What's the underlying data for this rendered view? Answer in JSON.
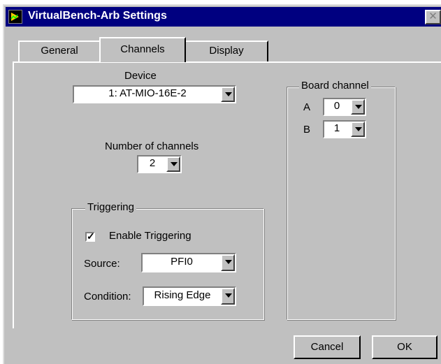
{
  "window": {
    "title": "VirtualBench-Arb Settings",
    "close_glyph": "✕"
  },
  "tabs": [
    {
      "label": "General"
    },
    {
      "label": "Channels",
      "active": true
    },
    {
      "label": "Display"
    }
  ],
  "device": {
    "label": "Device",
    "value": "1: AT-MIO-16E-2"
  },
  "num_channels": {
    "label": "Number of channels",
    "value": "2"
  },
  "triggering": {
    "title": "Triggering",
    "enable_label": "Enable Triggering",
    "enable_checked": true,
    "check_mark": "✓",
    "source_label": "Source:",
    "source_value": "PFI0",
    "condition_label": "Condition:",
    "condition_value": "Rising Edge"
  },
  "board_channel": {
    "title": "Board channel",
    "a_label": "A",
    "a_value": "0",
    "b_label": "B",
    "b_value": "1"
  },
  "buttons": {
    "cancel": "Cancel",
    "ok": "OK"
  },
  "colors": {
    "titlebar": "#000080",
    "face": "#c0c0c0"
  },
  "icons": {
    "app": "app-icon",
    "close": "close-icon",
    "dropdown": "chevron-down-icon"
  }
}
